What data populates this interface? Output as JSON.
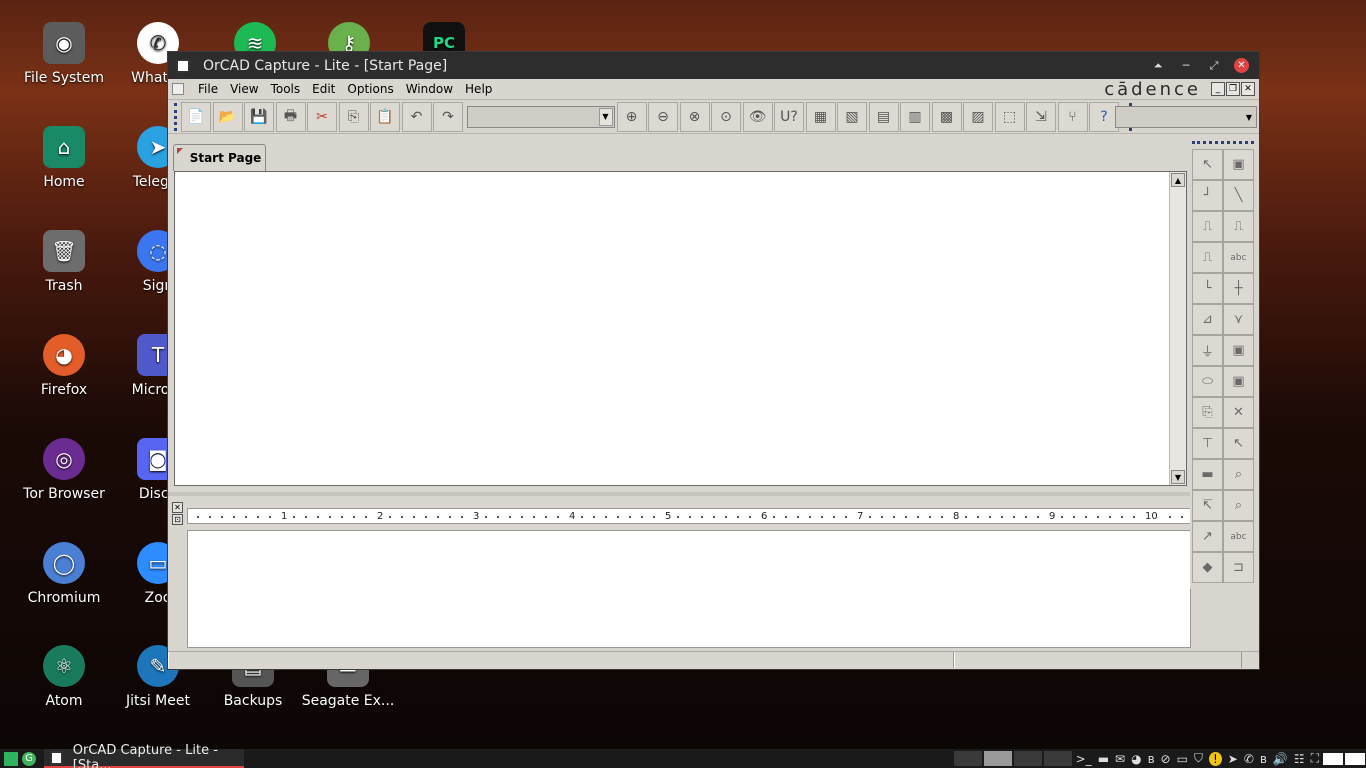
{
  "desktop": {
    "icons": [
      {
        "label": "File System",
        "glyph": "◉",
        "color": "#5c5c5c"
      },
      {
        "label": "Home",
        "glyph": "⌂",
        "color": "#1a8a66"
      },
      {
        "label": "Trash",
        "glyph": "🗑",
        "color": "#6d6d6d"
      },
      {
        "label": "Firefox",
        "glyph": "◕",
        "color": "#e25d2a"
      },
      {
        "label": "Tor Browser",
        "glyph": "◎",
        "color": "#6a2c91"
      },
      {
        "label": "Chromium",
        "glyph": "◯",
        "color": "#4a7fd4"
      },
      {
        "label": "Atom",
        "glyph": "⚛",
        "color": "#1a7a5e"
      },
      {
        "label": "WhatsA",
        "glyph": "✆",
        "color": "#ffffff"
      },
      {
        "label": "Telegra",
        "glyph": "➤",
        "color": "#2aa1e0"
      },
      {
        "label": "Sign",
        "glyph": "◌",
        "color": "#3a76f0"
      },
      {
        "label": "Microsc",
        "glyph": "T",
        "color": "#5059c9"
      },
      {
        "label": "Disco",
        "glyph": "◙",
        "color": "#5865f2"
      },
      {
        "label": "Zoo",
        "glyph": "▭",
        "color": "#2d8cff"
      },
      {
        "label": "Jitsi Meet",
        "glyph": "✎",
        "color": "#1d76ba"
      },
      {
        "label": "Backups",
        "glyph": "▤",
        "color": "#555555"
      },
      {
        "label": "Seagate Ex...",
        "glyph": "▬",
        "color": "#666666"
      }
    ],
    "top_partial_icons": [
      {
        "name": "spotify",
        "glyph": "≋",
        "color": "#1db954"
      },
      {
        "name": "keepass",
        "glyph": "⚷",
        "color": "#6ab04c"
      },
      {
        "name": "pycharm",
        "glyph": "PC",
        "color": "#21d789"
      }
    ]
  },
  "window": {
    "title": "OrCAD Capture - Lite - [Start Page]",
    "menu": [
      "File",
      "View",
      "Tools",
      "Edit",
      "Options",
      "Window",
      "Help"
    ],
    "brand": "cādence",
    "tab": "Start Page",
    "toolbar_icons": [
      "new-icon",
      "open-icon",
      "save-icon",
      "print-icon",
      "cut-icon",
      "copy-icon",
      "paste-icon",
      "undo-icon",
      "redo-icon",
      "zoom-in-icon",
      "zoom-out-icon",
      "zoom-area-icon",
      "zoom-all-icon",
      "eye-icon",
      "help-u-icon",
      "annotate-icon",
      "back-annotate-icon",
      "netlist-icon",
      "drc-icon",
      "crossref-icon",
      "bom-icon",
      "project-icon",
      "browse-icon",
      "tree-icon",
      "help-icon"
    ],
    "toolbar_glyphs": [
      "📄",
      "📂",
      "💾",
      "🖶",
      "✂",
      "⎘",
      "📋",
      "↶",
      "↷",
      "⊕",
      "⊖",
      "⊗",
      "⊙",
      "👁",
      "U?",
      "▦",
      "▧",
      "▤",
      "▥",
      "▩",
      "▨",
      "⬚",
      "⇲",
      "⑂",
      "?"
    ],
    "ruler_labels": [
      "1",
      "2",
      "3",
      "4",
      "5",
      "6",
      "7",
      "8",
      "9",
      "10"
    ],
    "palette_glyphs": [
      "↖",
      "▣",
      "┘",
      "╲",
      "⎍",
      "⎍",
      "⎍",
      "abc",
      "└",
      "┼",
      "⊿",
      "⋎",
      "⏚",
      "▣",
      "⬭",
      "▣",
      "⎘",
      "✕",
      "⊤",
      "↖",
      "▬",
      "⌕",
      "↸",
      "⌕",
      "↗",
      "abc",
      "◆",
      "⊐"
    ]
  },
  "taskbar": {
    "task_label": "OrCAD Capture - Lite - [Sta...",
    "tray_glyphs": [
      ">_",
      "▬",
      "✉",
      "◕",
      "ʙ",
      "⊘",
      "▭",
      "⛉",
      "!",
      "➤",
      "✆",
      "ʙ",
      "🔊",
      "☷",
      "⛶"
    ]
  }
}
